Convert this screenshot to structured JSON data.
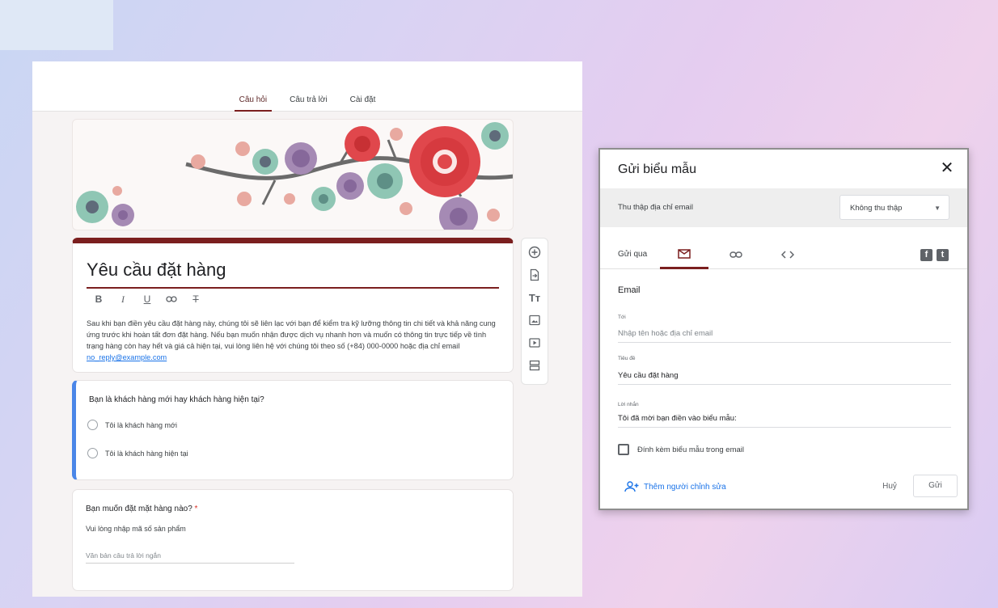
{
  "form": {
    "tabs": [
      {
        "label": "Câu hỏi",
        "active": true
      },
      {
        "label": "Câu trả lời",
        "active": false
      },
      {
        "label": "Cài đặt",
        "active": false
      }
    ],
    "title": "Yêu cầu đặt hàng",
    "description": "Sau khi bạn điền yêu cầu đặt hàng này, chúng tôi sẽ liên lạc với bạn để kiểm tra kỹ lưỡng thông tin chi tiết và khả năng cung ứng trước khi hoàn tất đơn đặt hàng. Nếu bạn muốn nhận được dịch vụ nhanh hơn và muốn có thông tin trực tiếp về tình trạng hàng còn hay hết và giá cả hiện tại, vui lòng liên hệ với chúng tôi theo số (+84) 000-0000 hoặc địa chỉ email",
    "description_link": "no_reply@example.com",
    "questions": {
      "q1": {
        "title": "Bạn là khách hàng mới hay khách hàng hiện tại?",
        "options": [
          "Tôi là khách hàng mới",
          "Tôi là khách hàng hiện tại"
        ]
      },
      "q2": {
        "title": "Bạn muốn đặt mặt hàng nào?",
        "required_mark": "*",
        "help": "Vui lòng nhập mã số sản phẩm",
        "answer_placeholder": "Văn bản câu trả lời ngắn"
      }
    },
    "format_tools": [
      "bold-icon",
      "italic-icon",
      "underline-icon",
      "link-icon",
      "clear-format-icon"
    ],
    "side_tools": [
      "add-question-icon",
      "import-questions-icon",
      "add-title-icon",
      "add-image-icon",
      "add-video-icon",
      "add-section-icon"
    ],
    "accent_color": "#7b1f1f",
    "highlight_color": "#4a86e8"
  },
  "dialog": {
    "title": "Gửi biểu mẫu",
    "close_icon": "close-icon",
    "collect_label": "Thu thập địa chỉ email",
    "collect_value": "Không thu thập",
    "send_via_label": "Gửi qua",
    "send_via_tabs": [
      "email-icon",
      "link-icon",
      "embed-icon"
    ],
    "social": [
      "facebook-icon",
      "twitter-icon"
    ],
    "email_heading": "Email",
    "to_label": "Tới",
    "to_placeholder": "Nhập tên hoặc địa chỉ email",
    "subject_label": "Tiêu đề",
    "subject_value": "Yêu cầu đặt hàng",
    "message_label": "Lời nhắn",
    "message_value": "Tôi đã mời bạn điền vào biểu mẫu:",
    "attach_label": "Đính kèm biểu mẫu trong email",
    "attach_checked": false,
    "add_editor": "Thêm người chỉnh sửa",
    "cancel": "Huỷ",
    "send": "Gửi"
  }
}
